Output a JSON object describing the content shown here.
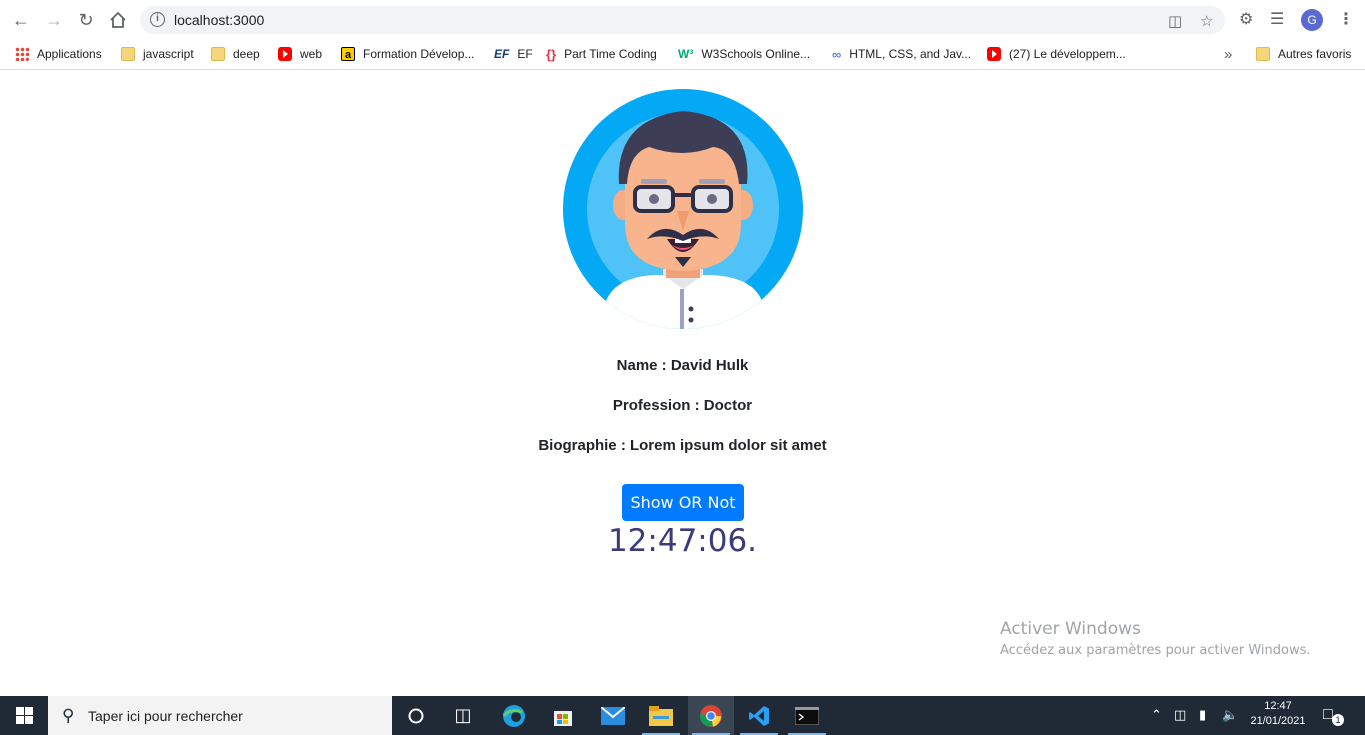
{
  "browser": {
    "url": "localhost:3000",
    "avatar_letter": "G",
    "bookmarks": [
      {
        "label": "Applications",
        "icon": "apps-grid-icon"
      },
      {
        "label": "javascript",
        "icon": "folder-icon"
      },
      {
        "label": "deep",
        "icon": "folder-icon"
      },
      {
        "label": "web",
        "icon": "youtube-icon"
      },
      {
        "label": "Formation Dévelop...",
        "icon": "amazon-icon"
      },
      {
        "label": "EF",
        "icon": "ef-icon"
      },
      {
        "label": "Part Time Coding",
        "icon": "ptc-icon"
      },
      {
        "label": "W3Schools Online...",
        "icon": "w3schools-icon"
      },
      {
        "label": "HTML, CSS, and Jav...",
        "icon": "link-icon"
      },
      {
        "label": "(27) Le développem...",
        "icon": "youtube-icon"
      }
    ],
    "overflow_label": "»",
    "other_bookmarks": "Autres favoris"
  },
  "profile": {
    "name_line": "Name : David Hulk",
    "profession_line": "Profession : Doctor",
    "bio_line": "Biographie : Lorem ipsum dolor sit amet",
    "toggle_button": "Show OR Not",
    "clock_text": "12:47:06."
  },
  "watermark": {
    "title": "Activer Windows",
    "subtitle": "Accédez aux paramètres pour activer Windows."
  },
  "taskbar": {
    "search_placeholder": "Taper ici pour rechercher",
    "time": "12:47",
    "date": "21/01/2021",
    "notification_count": "1"
  },
  "colors": {
    "button_bg": "#007bff",
    "clock_color": "#3c3b7a",
    "avatar_circle": "#03a9f4",
    "taskbar_bg": "#1f2a36"
  }
}
